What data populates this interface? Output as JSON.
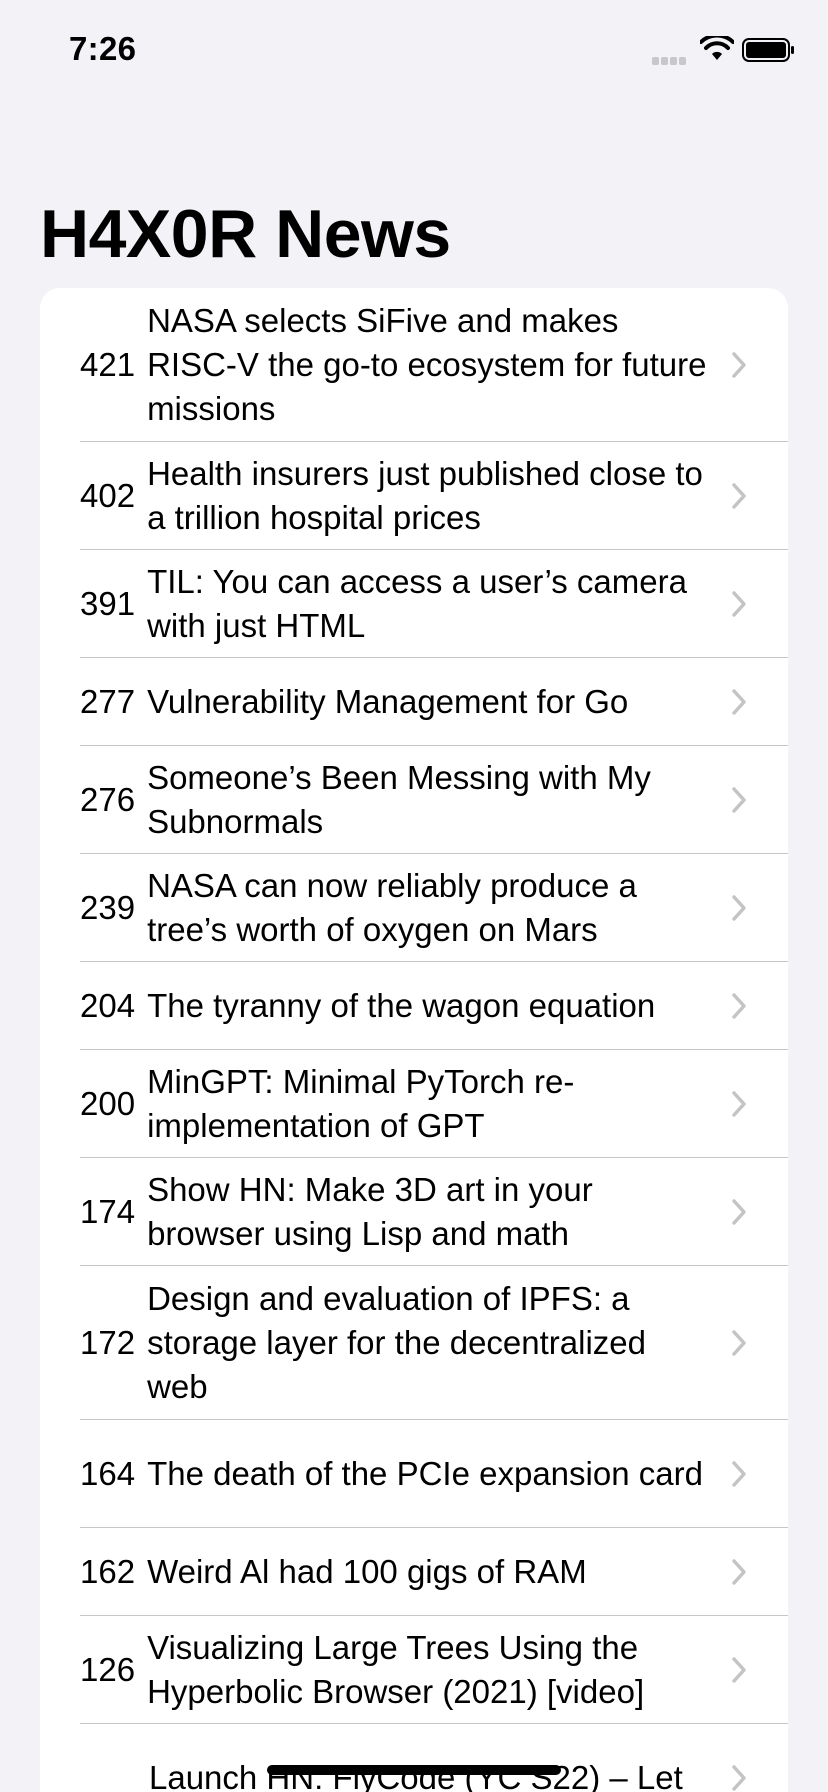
{
  "status_bar": {
    "time": "7:26"
  },
  "app": {
    "title": "H4X0R News"
  },
  "stories": [
    {
      "score": "421",
      "title": "NASA selects SiFive and makes RISC-V the go-to ecosystem for future missions"
    },
    {
      "score": "402",
      "title": "Health insurers just published close to a trillion hospital prices"
    },
    {
      "score": "391",
      "title": "TIL: You can access a user’s camera with just HTML"
    },
    {
      "score": "277",
      "title": "Vulnerability Management for Go"
    },
    {
      "score": "276",
      "title": "Someone’s Been Messing with My Subnormals"
    },
    {
      "score": "239",
      "title": "NASA can now reliably produce a tree’s worth of oxygen on Mars"
    },
    {
      "score": "204",
      "title": "The tyranny of the wagon equation"
    },
    {
      "score": "200",
      "title": "MinGPT: Minimal PyTorch re-implementation of GPT"
    },
    {
      "score": "174",
      "title": "Show HN: Make 3D art in your browser using Lisp and math"
    },
    {
      "score": "172",
      "title": "Design and evaluation of IPFS: a storage layer for the decentralized web"
    },
    {
      "score": "164",
      "title": "The death of the PCIe expansion card"
    },
    {
      "score": "162",
      "title": "Weird Al had 100 gigs of RAM"
    },
    {
      "score": "126",
      "title": "Visualizing Large Trees Using the Hyperbolic Browser (2021) [video]"
    },
    {
      "score": "",
      "title": "Launch HN: FlyCode (YC S22) – Let"
    }
  ]
}
